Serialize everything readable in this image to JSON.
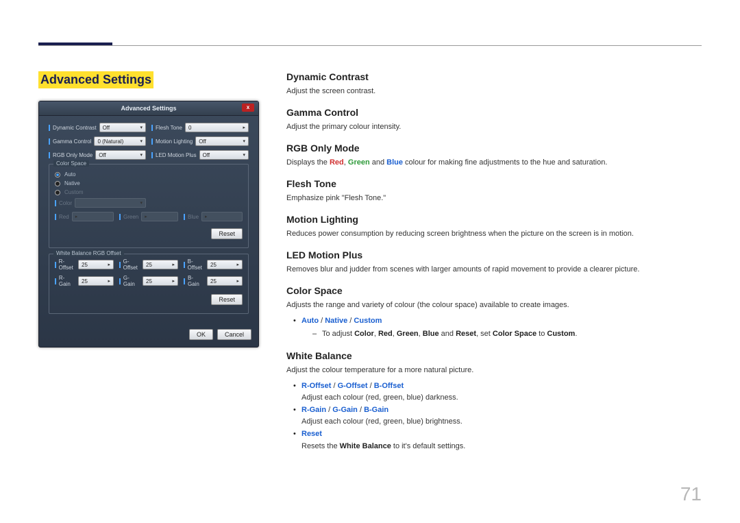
{
  "page_number": "71",
  "left": {
    "section_title": "Advanced Settings",
    "dialog": {
      "title": "Advanced Settings",
      "close": "x",
      "row1": [
        {
          "label": "Dynamic Contrast",
          "value": "Off"
        },
        {
          "label": "Flesh Tone",
          "value": "0"
        }
      ],
      "row2": [
        {
          "label": "Gamma Control",
          "value": "0 (Natural)"
        },
        {
          "label": "Motion Lighting",
          "value": "Off"
        }
      ],
      "row3": [
        {
          "label": "RGB Only Mode",
          "value": "Off"
        },
        {
          "label": "LED Motion Plus",
          "value": "Off"
        }
      ],
      "color_space": {
        "title": "Color Space",
        "opt_auto": "Auto",
        "opt_native": "Native",
        "opt_custom": "Custom",
        "row_color": {
          "label": "Color",
          "value": ""
        },
        "row_rgb": [
          {
            "label": "Red",
            "value": ""
          },
          {
            "label": "Green",
            "value": ""
          },
          {
            "label": "Blue",
            "value": ""
          }
        ],
        "reset": "Reset"
      },
      "white_balance": {
        "title": "White Balance RGB Offset",
        "offset_row": [
          {
            "label": "R-Offset",
            "value": "25"
          },
          {
            "label": "G-Offset",
            "value": "25"
          },
          {
            "label": "B-Offset",
            "value": "25"
          }
        ],
        "gain_row": [
          {
            "label": "R-Gain",
            "value": "25"
          },
          {
            "label": "G-Gain",
            "value": "25"
          },
          {
            "label": "B-Gain",
            "value": "25"
          }
        ],
        "reset": "Reset"
      },
      "ok": "OK",
      "cancel": "Cancel"
    }
  },
  "right": {
    "dynamic_contrast": {
      "h": "Dynamic Contrast",
      "p": "Adjust the screen contrast."
    },
    "gamma_control": {
      "h": "Gamma Control",
      "p": "Adjust the primary colour intensity."
    },
    "rgb_only_mode": {
      "h": "RGB Only Mode",
      "p_pre": "Displays the ",
      "red": "Red",
      "green": "Green",
      "blue": "Blue",
      "p_post": " colour for making fine adjustments to the hue and saturation."
    },
    "flesh_tone": {
      "h": "Flesh Tone",
      "p": "Emphasize pink \"Flesh Tone.\""
    },
    "motion_lighting": {
      "h": "Motion Lighting",
      "p": "Reduces power consumption by reducing screen brightness when the picture on the screen is in motion."
    },
    "led_motion_plus": {
      "h": "LED Motion Plus",
      "p": "Removes blur and judder from scenes with larger amounts of rapid movement to provide a clearer picture."
    },
    "color_space": {
      "h": "Color Space",
      "p": "Adjusts the range and variety of colour (the colour space) available to create images.",
      "opts": {
        "auto": "Auto",
        "sep": " / ",
        "native": "Native",
        "custom": "Custom"
      },
      "sub_pre": "To adjust ",
      "sub_words": {
        "color": "Color",
        "red": "Red",
        "green": "Green",
        "blue": "Blue",
        "reset": "Reset",
        "cs": "Color Space",
        "custom": "Custom"
      },
      "sub_mid1": " and ",
      "sub_mid2": ", set ",
      "sub_mid3": " to ",
      "sub_end": "."
    },
    "white_balance": {
      "h": "White Balance",
      "p": "Adjust the colour temperature for a more natural picture.",
      "offset": {
        "r": "R-Offset",
        "g": "G-Offset",
        "b": "B-Offset",
        "sep": " / ",
        "desc": "Adjust each colour (red, green, blue) darkness."
      },
      "gain": {
        "r": "R-Gain",
        "g": "G-Gain",
        "b": "B-Gain",
        "sep": " / ",
        "desc": "Adjust each colour (red, green, blue) brightness."
      },
      "reset": {
        "label": "Reset",
        "desc_pre": "Resets the ",
        "desc_bold": "White Balance",
        "desc_post": " to it's default settings."
      }
    }
  }
}
